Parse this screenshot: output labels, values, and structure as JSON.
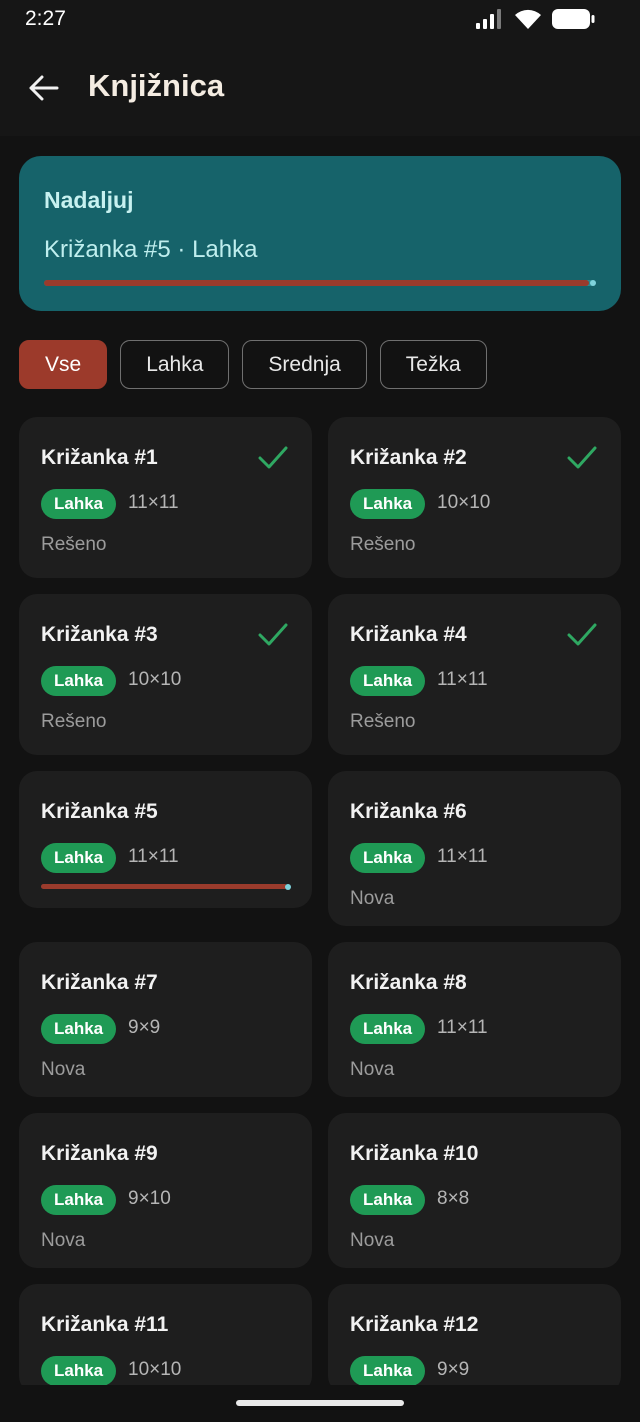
{
  "status_bar": {
    "time": "2:27"
  },
  "app_bar": {
    "title": "Knjižnica"
  },
  "continue_card": {
    "label": "Nadaljuj",
    "title": "Križanka #5 · Lahka",
    "progress": 0.99
  },
  "filters": [
    {
      "label": "Vse",
      "active": true
    },
    {
      "label": "Lahka",
      "active": false
    },
    {
      "label": "Srednja",
      "active": false
    },
    {
      "label": "Težka",
      "active": false
    }
  ],
  "puzzles": [
    {
      "title": "Križanka #1",
      "difficulty": "Lahka",
      "size": "11×11",
      "status": "Rešeno",
      "solved": true
    },
    {
      "title": "Križanka #2",
      "difficulty": "Lahka",
      "size": "10×10",
      "status": "Rešeno",
      "solved": true
    },
    {
      "title": "Križanka #3",
      "difficulty": "Lahka",
      "size": "10×10",
      "status": "Rešeno",
      "solved": true
    },
    {
      "title": "Križanka #4",
      "difficulty": "Lahka",
      "size": "11×11",
      "status": "Rešeno",
      "solved": true
    },
    {
      "title": "Križanka #5",
      "difficulty": "Lahka",
      "size": "11×11",
      "status": "",
      "solved": false,
      "progress": 0.99
    },
    {
      "title": "Križanka #6",
      "difficulty": "Lahka",
      "size": "11×11",
      "status": "Nova",
      "solved": false
    },
    {
      "title": "Križanka #7",
      "difficulty": "Lahka",
      "size": "9×9",
      "status": "Nova",
      "solved": false
    },
    {
      "title": "Križanka #8",
      "difficulty": "Lahka",
      "size": "11×11",
      "status": "Nova",
      "solved": false
    },
    {
      "title": "Križanka #9",
      "difficulty": "Lahka",
      "size": "9×10",
      "status": "Nova",
      "solved": false
    },
    {
      "title": "Križanka #10",
      "difficulty": "Lahka",
      "size": "8×8",
      "status": "Nova",
      "solved": false
    },
    {
      "title": "Križanka #11",
      "difficulty": "Lahka",
      "size": "10×10",
      "status": "",
      "solved": false
    },
    {
      "title": "Križanka #12",
      "difficulty": "Lahka",
      "size": "9×9",
      "status": "",
      "solved": false
    }
  ],
  "colors": {
    "accent": "#9c3a2b",
    "card_teal": "#16636a",
    "badge_green": "#1f9a55",
    "check_green": "#2fa862"
  },
  "icons": {
    "back": "arrow-left-icon",
    "check": "check-icon",
    "signal": "signal-icon",
    "wifi": "wifi-icon",
    "battery": "battery-icon"
  }
}
